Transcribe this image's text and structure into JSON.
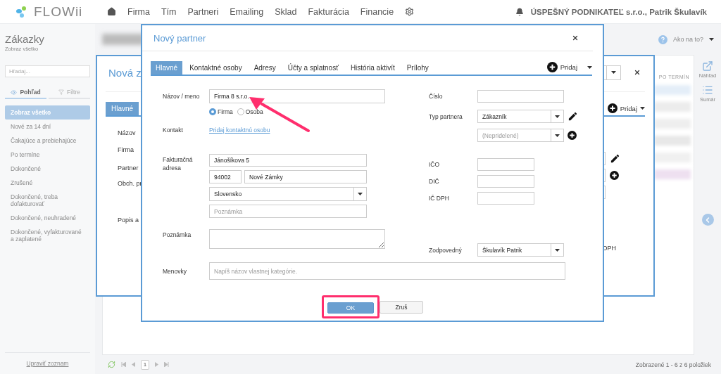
{
  "header": {
    "logo": "FLOWii",
    "nav": [
      "Firma",
      "Tím",
      "Partneri",
      "Emailing",
      "Sklad",
      "Fakturácia",
      "Financie"
    ],
    "account": "ÚSPEŠNÝ PODNIKATEĽ s.r.o., Patrik Škulavík"
  },
  "sidebar": {
    "title": "Zákazky",
    "subtitle": "Zobraz všetko",
    "search": {
      "placeholder": "Hľadaj..."
    },
    "tabs": [
      {
        "label": "Pohľad",
        "selected": true
      },
      {
        "label": "Filtre",
        "selected": false
      }
    ],
    "items": [
      {
        "label": "Zobraz všetko",
        "selected": true
      },
      {
        "label": "Nové za 14 dní",
        "selected": false
      },
      {
        "label": "Čakajúce a prebiehajúce",
        "selected": false
      },
      {
        "label": "Po termíne",
        "selected": false
      },
      {
        "label": "Dokončené",
        "selected": false
      },
      {
        "label": "Zrušené",
        "selected": false
      },
      {
        "label": "Dokončené, treba dofakturovať",
        "selected": false
      },
      {
        "label": "Dokončené, neuhradené",
        "selected": false
      },
      {
        "label": "Dokončené, vyfakturované a zaplatené",
        "selected": false
      }
    ],
    "edit_link": "Upraviť zoznam"
  },
  "help": {
    "label": "Ako na to?"
  },
  "rail": [
    {
      "label": "Náhľad"
    },
    {
      "label": "Sumár"
    }
  ],
  "list": {
    "column_header": "PO TERMÍN",
    "page": "1",
    "status": "Zobrazené 1 - 6 z 6 položiek"
  },
  "background_dialog": {
    "title": "Nová z",
    "tabs": [
      {
        "label": "Hlavné",
        "selected": true
      }
    ],
    "add_label": "Pridaj",
    "labels": [
      "Názov",
      "Firma",
      "Partner",
      "Obch. pr",
      "Popis a"
    ],
    "side_label": "DPH"
  },
  "dialog": {
    "title": "Nový partner",
    "tabs": [
      {
        "label": "Hlavné",
        "selected": true
      },
      {
        "label": "Kontaktné osoby",
        "selected": false
      },
      {
        "label": "Adresy",
        "selected": false
      },
      {
        "label": "Účty a splatnosť",
        "selected": false
      },
      {
        "label": "História aktivít",
        "selected": false
      },
      {
        "label": "Prílohy",
        "selected": false
      }
    ],
    "add_label": "Pridaj",
    "name": {
      "label": "Názov / meno",
      "value": "Firma 8 s.r.o."
    },
    "partner_kind": [
      {
        "label": "Firma",
        "selected": true
      },
      {
        "label": "Osoba",
        "selected": false
      }
    ],
    "contact": {
      "label": "Kontakt",
      "link": "Pridaj kontaktnú osobu"
    },
    "billing_address": {
      "label": "Fakturačná adresa",
      "street": "Jánošíkova 5",
      "zip": "94002",
      "city": "Nové Zámky",
      "country": "Slovensko",
      "note_placeholder": "Poznámka"
    },
    "note": {
      "label": "Poznámka"
    },
    "tags": {
      "label": "Menovky",
      "placeholder": "Napíš názov vlastnej kategórie."
    },
    "number": {
      "label": "Číslo"
    },
    "partner_type": {
      "label": "Typ partnera",
      "value": "Zákazník"
    },
    "partner_group": {
      "placeholder": "(Nepridelené)"
    },
    "ico": {
      "label": "IČO"
    },
    "dic": {
      "label": "DIČ"
    },
    "ic_dph": {
      "label": "IČ DPH"
    },
    "responsible": {
      "label": "Zodpovedný",
      "value": "Škulavík Patrik"
    },
    "buttons": [
      {
        "label": "OK",
        "kind": "primary"
      },
      {
        "label": "Zruš",
        "kind": "secondary"
      }
    ]
  }
}
